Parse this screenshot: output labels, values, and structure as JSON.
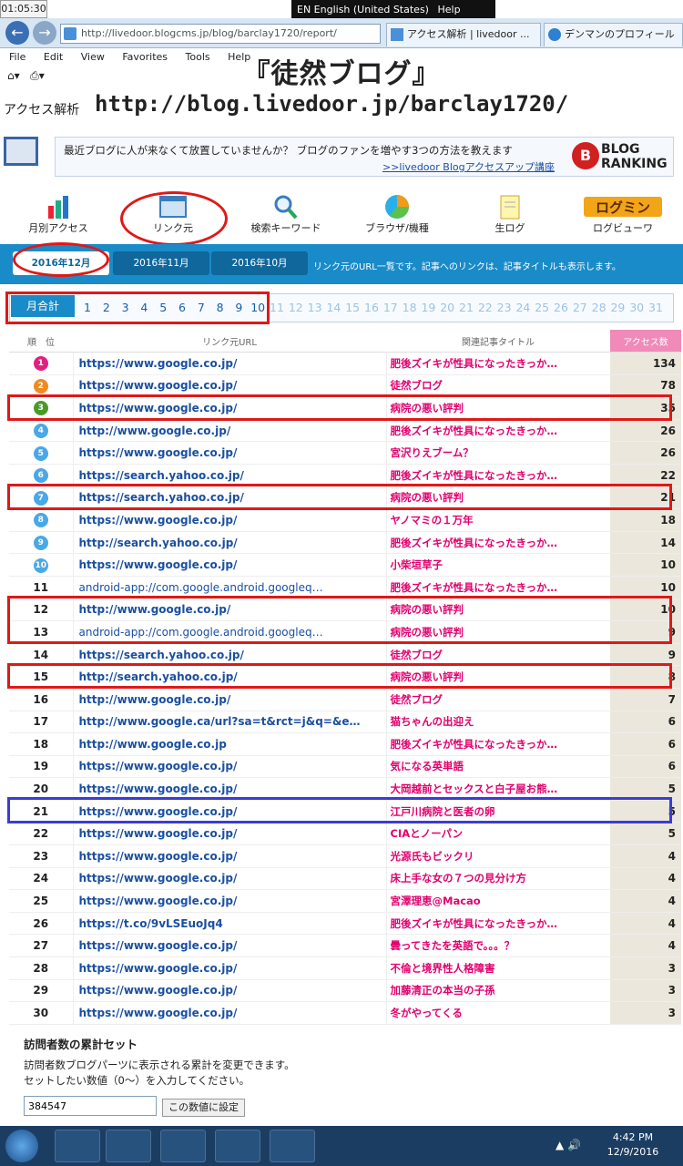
{
  "system": {
    "clock": "01:05:30",
    "lang": "EN English (United States)",
    "help": "Help"
  },
  "browser": {
    "address": "http://livedoor.blogcms.jp/blog/barclay1720/report/",
    "tabs": [
      "アクセス解析 | livedoor ...",
      "デンマンのプロフィール"
    ],
    "menu": [
      "File",
      "Edit",
      "View",
      "Favorites",
      "Tools",
      "Help"
    ]
  },
  "page": {
    "blog_name": "『徒然ブログ』",
    "access_label": "アクセス解析",
    "blog_url": "http://blog.livedoor.jp/barclay1720/",
    "banner_text": "最近ブログに人が来なくて放置していませんか？ ブログのファンを増やす3つの方法を教えます",
    "banner_link": ">>livedoor Blogアクセスアップ講座",
    "ranking_logo_line1": "BLOG",
    "ranking_logo_line2": "RANKING"
  },
  "nav": [
    "月別アクセス",
    "リンク元",
    "検索キーワード",
    "ブラウザ/機種",
    "生ログ",
    "ログビューワ"
  ],
  "months": [
    "2016年12月",
    "2016年11月",
    "2016年10月"
  ],
  "subnav_note": "リンク元のURL一覧です。記事へのリンクは、記事タイトルも表示します。",
  "month_total": "月合計",
  "days": [
    "1",
    "2",
    "3",
    "4",
    "5",
    "6",
    "7",
    "8",
    "9",
    "10",
    "11",
    "12",
    "13",
    "14",
    "15",
    "16",
    "17",
    "18",
    "19",
    "20",
    "21",
    "22",
    "23",
    "24",
    "25",
    "26",
    "27",
    "28",
    "29",
    "30",
    "31"
  ],
  "table": {
    "headers": [
      "順　位",
      "リンク元URL",
      "関連記事タイトル",
      "アクセス数"
    ],
    "rows": [
      {
        "rank": "1",
        "url": "https://www.google.co.jp/",
        "title": "肥後ズイキが性具になったきっか…",
        "count": "134"
      },
      {
        "rank": "2",
        "url": "https://www.google.co.jp/",
        "title": "徒然ブログ",
        "count": "78"
      },
      {
        "rank": "3",
        "url": "https://www.google.co.jp/",
        "title": "病院の悪い評判",
        "count": "35"
      },
      {
        "rank": "4",
        "url": "http://www.google.co.jp/",
        "title": "肥後ズイキが性具になったきっか…",
        "count": "26"
      },
      {
        "rank": "5",
        "url": "https://www.google.co.jp/",
        "title": "宮沢りえブーム？",
        "count": "26"
      },
      {
        "rank": "6",
        "url": "https://search.yahoo.co.jp/",
        "title": "肥後ズイキが性具になったきっか…",
        "count": "22"
      },
      {
        "rank": "7",
        "url": "https://search.yahoo.co.jp/",
        "title": "病院の悪い評判",
        "count": "21"
      },
      {
        "rank": "8",
        "url": "https://www.google.co.jp/",
        "title": "ヤノマミの１万年",
        "count": "18"
      },
      {
        "rank": "9",
        "url": "http://search.yahoo.co.jp/",
        "title": "肥後ズイキが性具になったきっか…",
        "count": "14"
      },
      {
        "rank": "10",
        "url": "https://www.google.co.jp/",
        "title": "小柴垣草子",
        "count": "10"
      },
      {
        "rank": "11",
        "url": "android-app://com.google.android.googleq…",
        "title": "肥後ズイキが性具になったきっか…",
        "count": "10"
      },
      {
        "rank": "12",
        "url": "http://www.google.co.jp/",
        "title": "病院の悪い評判",
        "count": "10"
      },
      {
        "rank": "13",
        "url": "android-app://com.google.android.googleq…",
        "title": "病院の悪い評判",
        "count": "9"
      },
      {
        "rank": "14",
        "url": "https://search.yahoo.co.jp/",
        "title": "徒然ブログ",
        "count": "9"
      },
      {
        "rank": "15",
        "url": "http://search.yahoo.co.jp/",
        "title": "病院の悪い評判",
        "count": "8"
      },
      {
        "rank": "16",
        "url": "http://www.google.co.jp/",
        "title": "徒然ブログ",
        "count": "7"
      },
      {
        "rank": "17",
        "url": "http://www.google.ca/url?sa=t&rct=j&q=&e…",
        "title": "猫ちゃんの出迎え",
        "count": "6"
      },
      {
        "rank": "18",
        "url": "http://www.google.co.jp",
        "title": "肥後ズイキが性具になったきっか…",
        "count": "6"
      },
      {
        "rank": "19",
        "url": "https://www.google.co.jp/",
        "title": "気になる英単語",
        "count": "6"
      },
      {
        "rank": "20",
        "url": "https://www.google.co.jp/",
        "title": "大岡越前とセックスと白子屋お熊…",
        "count": "5"
      },
      {
        "rank": "21",
        "url": "https://www.google.co.jp/",
        "title": "江戸川病院と医者の卵",
        "count": "5"
      },
      {
        "rank": "22",
        "url": "https://www.google.co.jp/",
        "title": "CIAとノーパン",
        "count": "5"
      },
      {
        "rank": "23",
        "url": "https://www.google.co.jp/",
        "title": "光源氏もビックリ",
        "count": "4"
      },
      {
        "rank": "24",
        "url": "https://www.google.co.jp/",
        "title": "床上手な女の７つの見分け方",
        "count": "4"
      },
      {
        "rank": "25",
        "url": "https://www.google.co.jp/",
        "title": "宮澤理恵@Macao",
        "count": "4"
      },
      {
        "rank": "26",
        "url": "https://t.co/9vLSEuoJq4",
        "title": "肥後ズイキが性具になったきっか…",
        "count": "4"
      },
      {
        "rank": "27",
        "url": "https://www.google.co.jp/",
        "title": "曇ってきたを英語で。。。？",
        "count": "4"
      },
      {
        "rank": "28",
        "url": "https://www.google.co.jp/",
        "title": "不倫と境界性人格障害",
        "count": "3"
      },
      {
        "rank": "29",
        "url": "https://www.google.co.jp/",
        "title": "加藤清正の本当の子孫",
        "count": "3"
      },
      {
        "rank": "30",
        "url": "https://www.google.co.jp/",
        "title": "冬がやってくる",
        "count": "3"
      }
    ]
  },
  "reset": {
    "title": "訪問者数の累計セット",
    "desc1": "訪問者数ブログパーツに表示される累計を変更できます。",
    "desc2": "セットしたい数値（0〜）を入力してください。",
    "value": "384547",
    "button": "この数値に設定"
  },
  "taskbar": {
    "time": "4:42 PM",
    "date": "12/9/2016"
  }
}
